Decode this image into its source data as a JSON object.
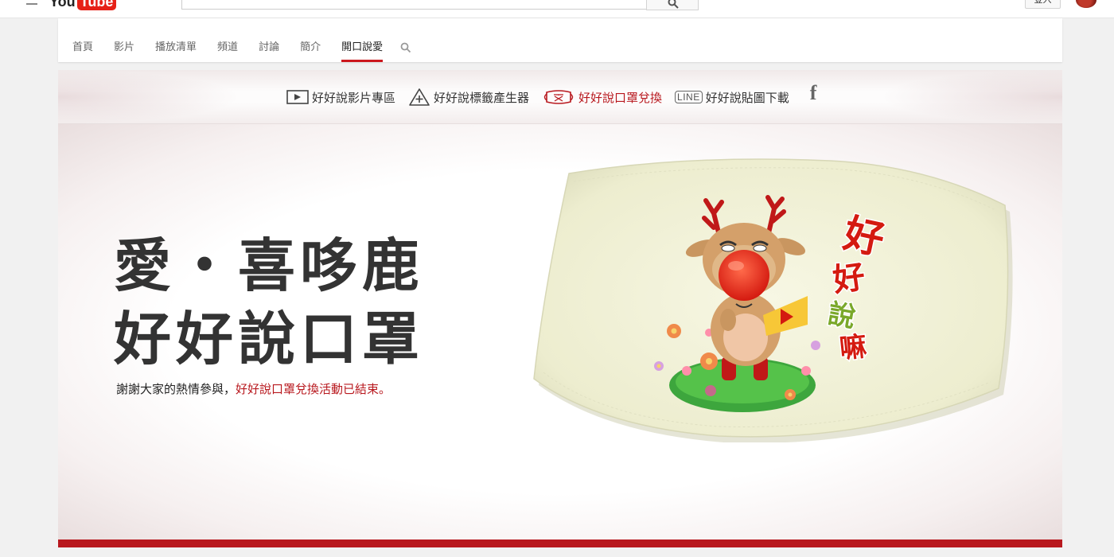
{
  "masthead": {
    "logo_you": "You",
    "logo_tube": "Tube",
    "signin_label": "登入"
  },
  "channel_nav": {
    "tabs": [
      {
        "label": "首頁",
        "active": false
      },
      {
        "label": "影片",
        "active": false
      },
      {
        "label": "播放清單",
        "active": false
      },
      {
        "label": "頻道",
        "active": false
      },
      {
        "label": "討論",
        "active": false
      },
      {
        "label": "簡介",
        "active": false
      },
      {
        "label": "開口說愛",
        "active": true
      }
    ],
    "search_icon": "search-icon"
  },
  "banner": {
    "menu": [
      {
        "label": "好好說影片專區",
        "icon": "play-icon",
        "active": false
      },
      {
        "label": "好好說標籤產生器",
        "icon": "tag-plus-icon",
        "active": false
      },
      {
        "label": "好好說口罩兌換",
        "icon": "mask-icon",
        "active": true
      },
      {
        "label": "好好說貼圖下載",
        "icon": "line-icon",
        "active": false
      }
    ],
    "line_text": "LINE",
    "facebook_glyph": "f",
    "headline_line1": "愛・喜哆鹿",
    "headline_line2": "好好說口罩",
    "notice_prefix": "謝謝大家的熱情參與，",
    "notice_highlight": "好好說口罩兌換活動已結束。",
    "art_text": {
      "char1": "好",
      "char2": "好",
      "char3": "說",
      "char4": "嘛"
    }
  },
  "colors": {
    "accent_red": "#b8181e",
    "youtube_red": "#e62117",
    "mask_cream": "#f3f3dc"
  }
}
